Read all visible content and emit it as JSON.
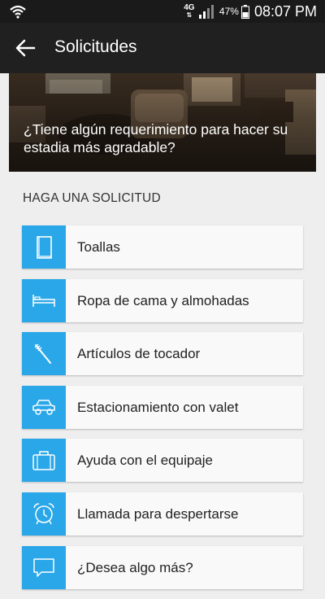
{
  "status_bar": {
    "network": "4G",
    "battery_percent": "47%",
    "time": "08:07 PM"
  },
  "app_bar": {
    "title": "Solicitudes",
    "back_icon": "arrow-left-icon"
  },
  "hero": {
    "text": "¿Tiene algún requerimiento para hacer su estadia más agradable?"
  },
  "section": {
    "header": "HAGA UNA SOLICITUD"
  },
  "requests": [
    {
      "label": "Toallas",
      "icon": "towel-icon"
    },
    {
      "label": "Ropa de cama y almohadas",
      "icon": "bed-icon"
    },
    {
      "label": "Artículos de tocador",
      "icon": "toothbrush-icon"
    },
    {
      "label": "Estacionamiento con valet",
      "icon": "car-icon"
    },
    {
      "label": "Ayuda con el equipaje",
      "icon": "luggage-icon"
    },
    {
      "label": "Llamada para despertarse",
      "icon": "alarm-clock-icon"
    },
    {
      "label": "¿Desea algo más?",
      "icon": "chat-bubble-icon"
    }
  ],
  "colors": {
    "accent": "#2aa7e8",
    "app_bar": "#202020",
    "status_bar": "#1a1a1a",
    "background": "#eeeeee"
  }
}
